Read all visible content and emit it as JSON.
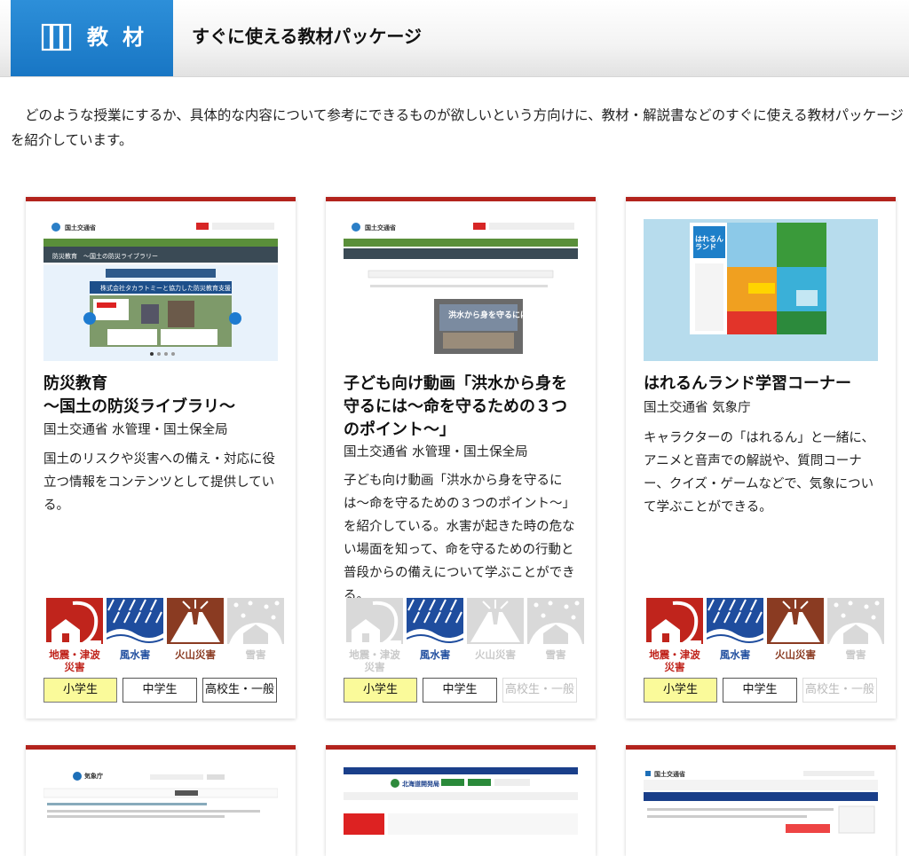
{
  "header": {
    "tag_label": "教材",
    "title": "すぐに使える教材パッケージ"
  },
  "intro": "どのような授業にするか、具体的な内容について参考にできるものが欲しいという方向けに、教材・解説書などのすぐに使える教材パッケージを紹介しています。",
  "hazard_labels": {
    "earthquake_line1": "地震・津波",
    "earthquake_line2": "災害",
    "flood": "風水害",
    "volcano": "火山災害",
    "snow": "雪害"
  },
  "level_labels": {
    "elementary": "小学生",
    "junior_high": "中学生",
    "high_school": "高校生・一般"
  },
  "colors": {
    "accent_red": "#b3231d",
    "earthquake": "#c0241c",
    "flood": "#1f4d9e",
    "volcano": "#8a3b22",
    "snow_inactive": "#d9d9d9",
    "level_active_bg": "#fafa9a",
    "header_blue": "#1876c4"
  },
  "cards": [
    {
      "title_line1": "防災教育",
      "title_line2": "〜国土の防災ライブラリ〜",
      "org": "国土交通省 水管理・国土保全局",
      "description": "国土のリスクや災害への備え・対応に役立つ情報をコンテンツとして提供している。",
      "thumb_text": {
        "site": "国土交通省",
        "section": "防災教育　〜国土の防災ライブラリー",
        "banner": "株式会社タカラトミーと協力した防災教育支援"
      },
      "hazards_active": {
        "earthquake": true,
        "flood": true,
        "volcano": true,
        "snow": false
      },
      "levels_active": {
        "elementary": "active",
        "junior_high": "normal",
        "high_school": "normal"
      }
    },
    {
      "title_line1": "子ども向け動画「洪水から身を",
      "title_line2": "守るには〜命を守るための３つ",
      "title_line3": "のポイント〜」",
      "org": "国土交通省 水管理・国土保全局",
      "description": "子ども向け動画「洪水から身を守るには〜命を守るための３つのポイント〜」を紹介している。水害が起きた時の危ない場面を知って、命を守るための行動と普段からの備えについて学ぶことができる。",
      "thumb_text": {
        "site": "国土交通省",
        "video": "洪水から身を守るには"
      },
      "hazards_active": {
        "earthquake": false,
        "flood": true,
        "volcano": false,
        "snow": false
      },
      "levels_active": {
        "elementary": "active",
        "junior_high": "normal",
        "high_school": "off"
      }
    },
    {
      "title_line1": "はれるんランド学習コーナー",
      "org": "国土交通省 気象庁",
      "description": "キャラクターの「はれるん」と一緒に、アニメと音声での解説や、質問コーナー、クイズ・ゲームなどで、気象について学ぶことができる。",
      "thumb_text": {
        "logo": "はれるん ランド"
      },
      "hazards_active": {
        "earthquake": true,
        "flood": true,
        "volcano": true,
        "snow": false
      },
      "levels_active": {
        "elementary": "active",
        "junior_high": "normal",
        "high_school": "off"
      }
    }
  ],
  "lower_cards": [
    {
      "site": "気象庁"
    },
    {
      "site": "北海道開発局"
    },
    {
      "site": "国土交通省"
    }
  ]
}
